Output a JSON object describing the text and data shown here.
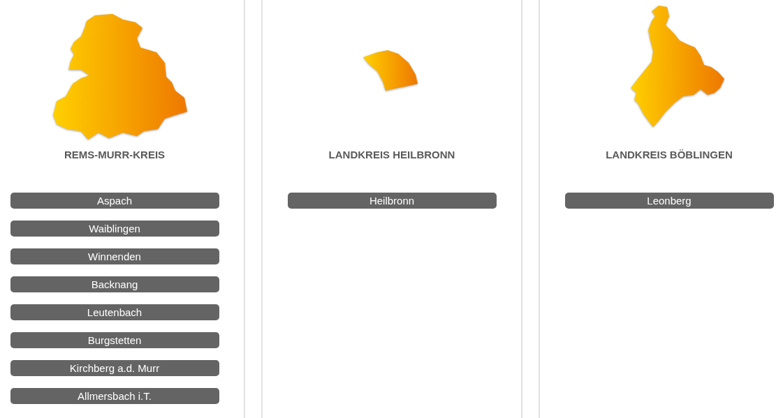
{
  "districts": [
    {
      "title": "REMS-MURR-KREIS",
      "towns": [
        "Aspach",
        "Waiblingen",
        "Winnenden",
        "Backnang",
        "Leutenbach",
        "Burgstetten",
        "Kirchberg a.d. Murr",
        "Allmersbach i.T."
      ]
    },
    {
      "title": "LANDKREIS HEILBRONN",
      "towns": [
        "Heilbronn"
      ]
    },
    {
      "title": "LANDKREIS BÖBLINGEN",
      "towns": [
        "Leonberg"
      ]
    }
  ]
}
